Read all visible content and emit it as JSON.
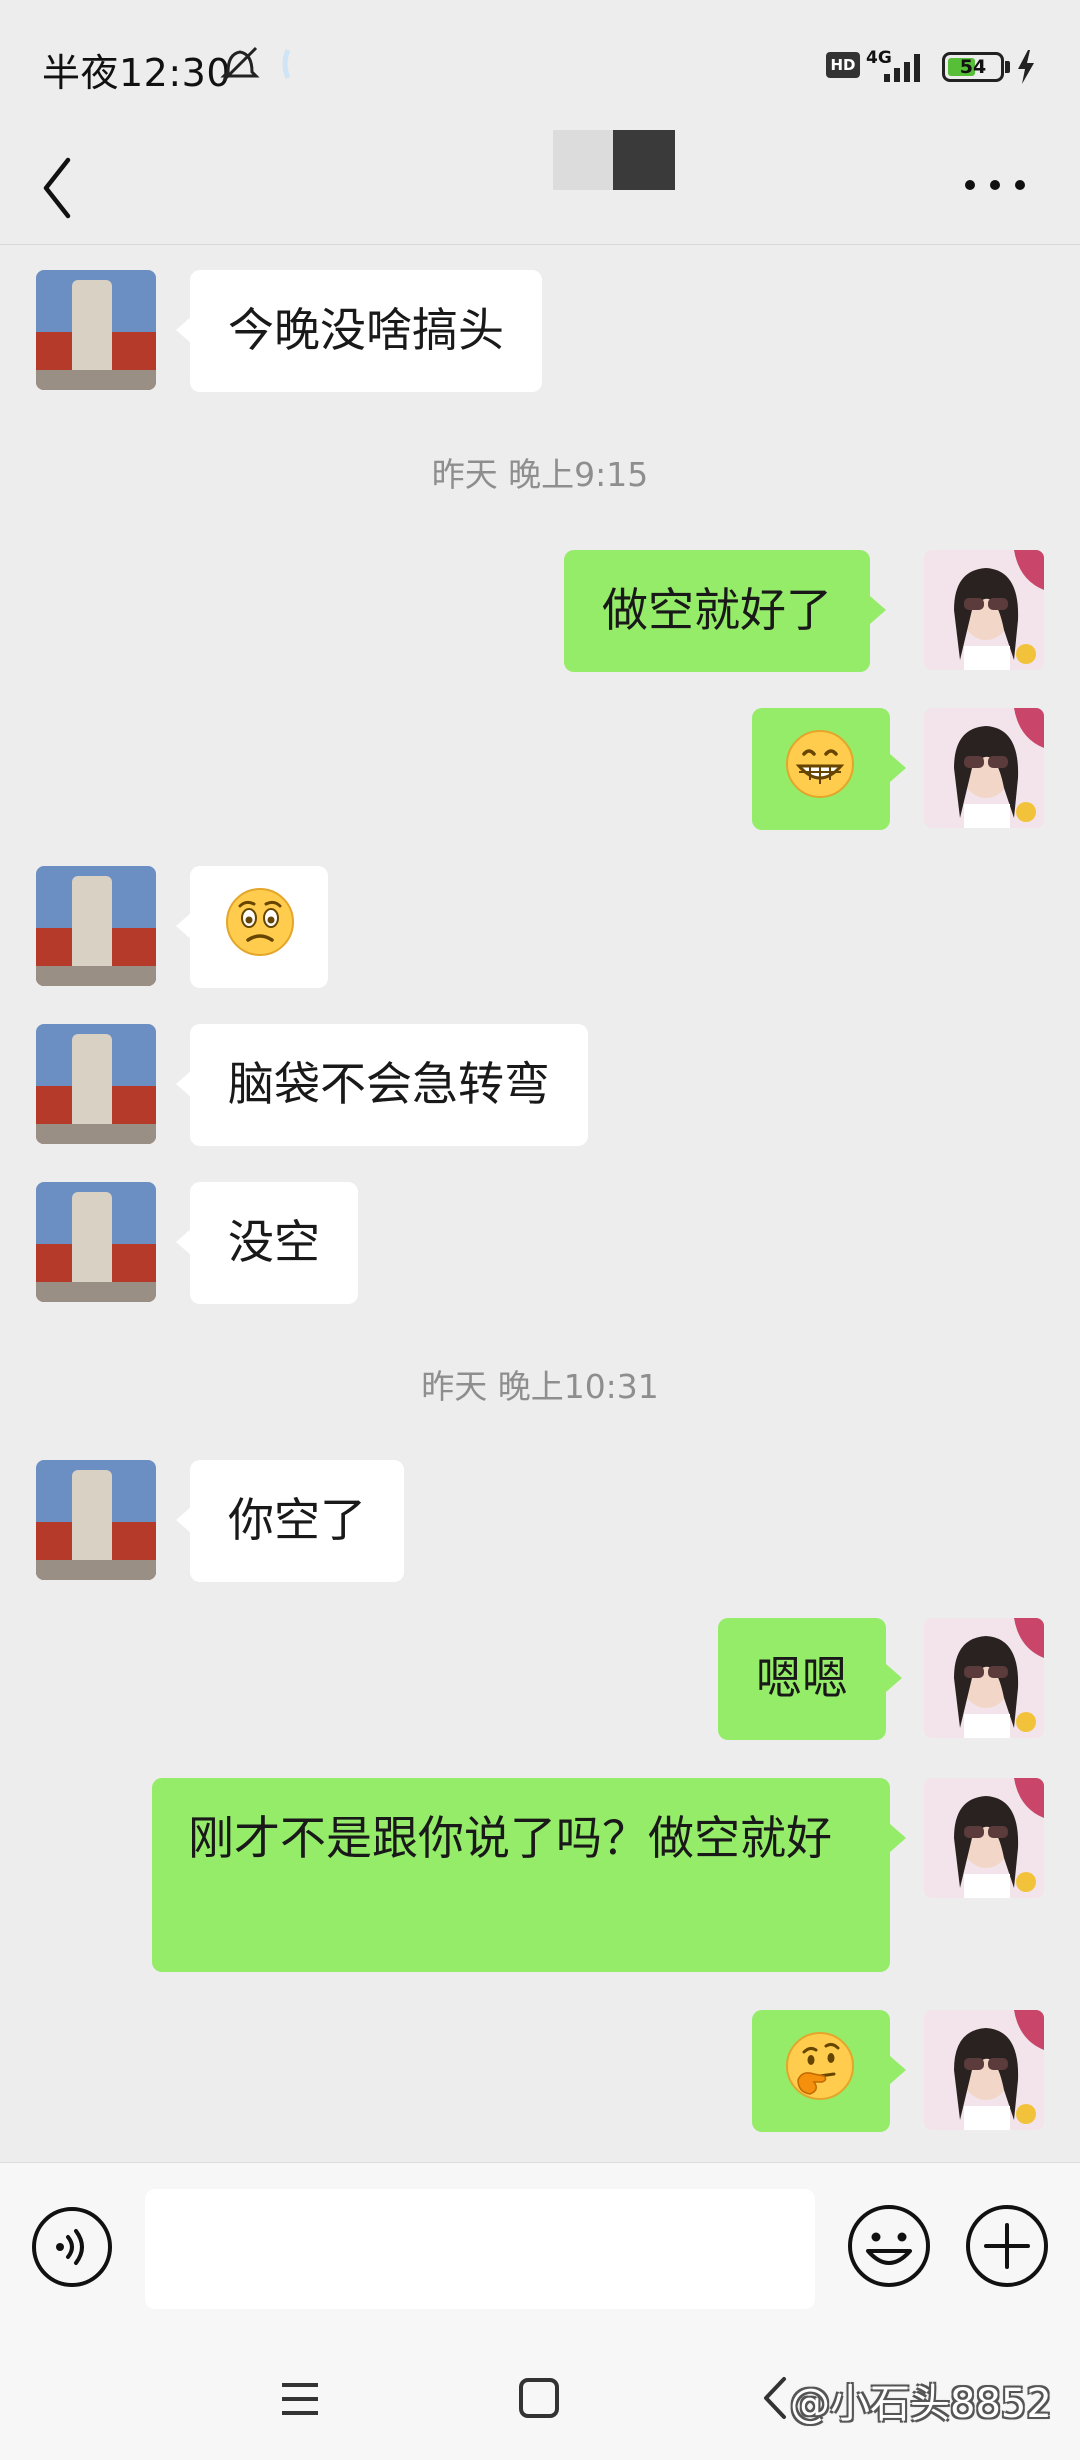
{
  "status_bar": {
    "time": "半夜12:30",
    "network": "4G",
    "hd_badge": "HD",
    "battery_level": "54",
    "battery_percent": 54
  },
  "header": {
    "contact_name_redacted": true
  },
  "colors": {
    "background": "#ededed",
    "outgoing_bubble": "#95ec69",
    "incoming_bubble": "#ffffff",
    "timestamp_text": "#8e8e8e"
  },
  "messages": [
    {
      "direction": "in",
      "type": "text",
      "text": "今晚没啥搞头"
    },
    {
      "type": "timestamp",
      "text": "昨天 晚上9:15"
    },
    {
      "direction": "out",
      "type": "text",
      "text": "做空就好了"
    },
    {
      "direction": "out",
      "type": "emoji",
      "emoji": "grin-emoji"
    },
    {
      "direction": "in",
      "type": "emoji",
      "emoji": "worried-emoji"
    },
    {
      "direction": "in",
      "type": "text",
      "text": "脑袋不会急转弯"
    },
    {
      "direction": "in",
      "type": "text",
      "text": "没空"
    },
    {
      "type": "timestamp",
      "text": "昨天 晚上10:31"
    },
    {
      "direction": "in",
      "type": "text",
      "text": "你空了"
    },
    {
      "direction": "out",
      "type": "text",
      "text": "嗯嗯"
    },
    {
      "direction": "out",
      "type": "text",
      "text": "刚才不是跟你说了吗？做空就好"
    },
    {
      "direction": "out",
      "type": "emoji",
      "emoji": "thinking-emoji"
    }
  ],
  "input": {
    "value": "",
    "placeholder": ""
  },
  "watermark": "@小石头8852"
}
